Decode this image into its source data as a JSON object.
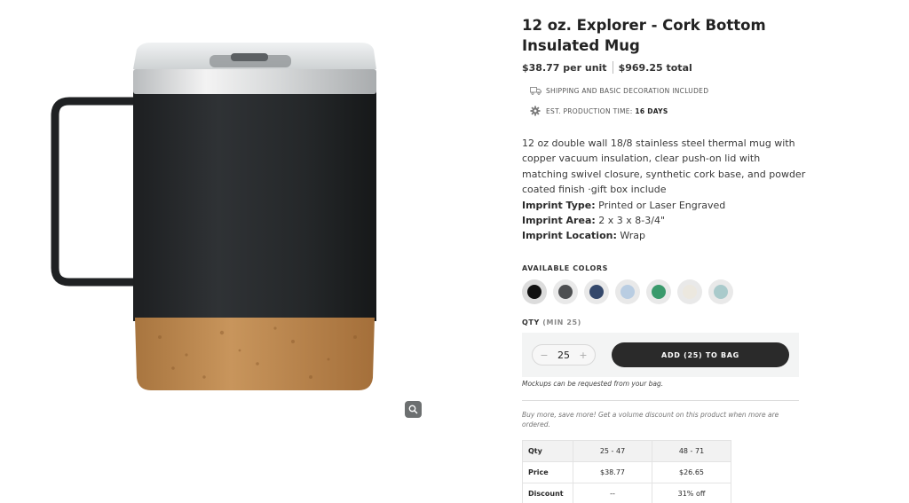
{
  "product": {
    "title": "12 oz. Explorer - Cork Bottom Insulated Mug",
    "price_per_unit": "$38.77 per unit",
    "price_total": "$969.25 total"
  },
  "meta": {
    "shipping": "SHIPPING AND BASIC DECORATION INCLUDED",
    "production_label": "EST. PRODUCTION TIME:",
    "production_value": "16 DAYS"
  },
  "description": {
    "text": "12 oz double wall 18/8 stainless steel thermal mug with copper vacuum insulation, clear push-on lid with matching swivel closure, synthetic cork base, and powder coated finish ·gift box include",
    "imprint_type_label": "Imprint Type:",
    "imprint_type_value": "Printed or Laser Engraved",
    "imprint_area_label": "Imprint Area:",
    "imprint_area_value": "2 x 3 x 8-3/4\"",
    "imprint_location_label": "Imprint Location:",
    "imprint_location_value": "Wrap"
  },
  "colors": {
    "label": "AVAILABLE COLORS",
    "swatches": [
      "#111111",
      "#4d4f51",
      "#34486b",
      "#b9cde2",
      "#3a9a6c",
      "#ece8df",
      "#a9cacb"
    ]
  },
  "quantity": {
    "label": "QTY",
    "min_label": "(MIN 25)",
    "value": "25",
    "minus": "−",
    "plus": "+",
    "add_button": "ADD (25) TO BAG"
  },
  "notes": {
    "mockups": "Mockups can be requested from your bag.",
    "volume": "Buy more, save more! Get a volume discount on this product when more are ordered."
  },
  "pricing_table": {
    "headers": [
      "Qty",
      "25 - 47",
      "48 - 71"
    ],
    "rows": [
      [
        "Price",
        "$38.77",
        "$26.65"
      ],
      [
        "Discount",
        "--",
        "31% off"
      ]
    ]
  },
  "icons": {
    "zoom": "zoom-icon",
    "shipping": "truck-icon",
    "production": "gear-icon"
  }
}
